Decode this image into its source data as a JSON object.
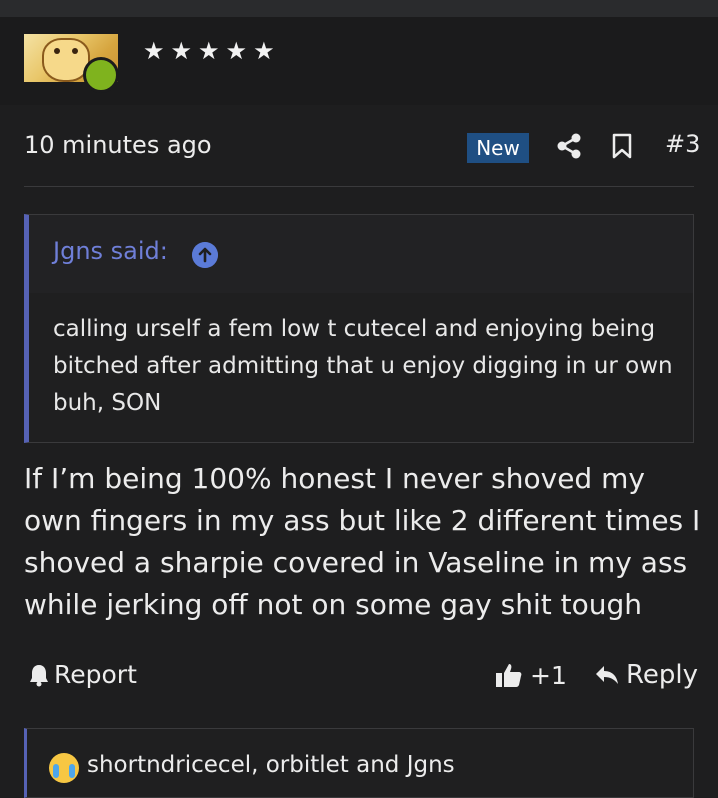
{
  "user": {
    "rating_stars": "★★★★★"
  },
  "post": {
    "time": "10 minutes ago",
    "badge": "New",
    "number": "#3",
    "body": "If I’m being 100% honest I never shoved my own fingers in my ass but like 2 different times I shoved a sharpie covered in Vaseline in my ass while jerking off not on some gay shit tough"
  },
  "quote": {
    "author": "Jgns said:",
    "text": "calling urself a fem low t cutecel and enjoying being bitched after admitting that u enjoy digging in ur own buh, SON"
  },
  "actions": {
    "report": "Report",
    "likes": "+1",
    "reply": "Reply"
  },
  "reactions": {
    "users": "shortndricecel, orbitlet and Jgns"
  },
  "colors": {
    "accent": "#5662b5",
    "badge": "#1f4f83",
    "online": "#7fb31e",
    "link": "#6f7fd8"
  }
}
